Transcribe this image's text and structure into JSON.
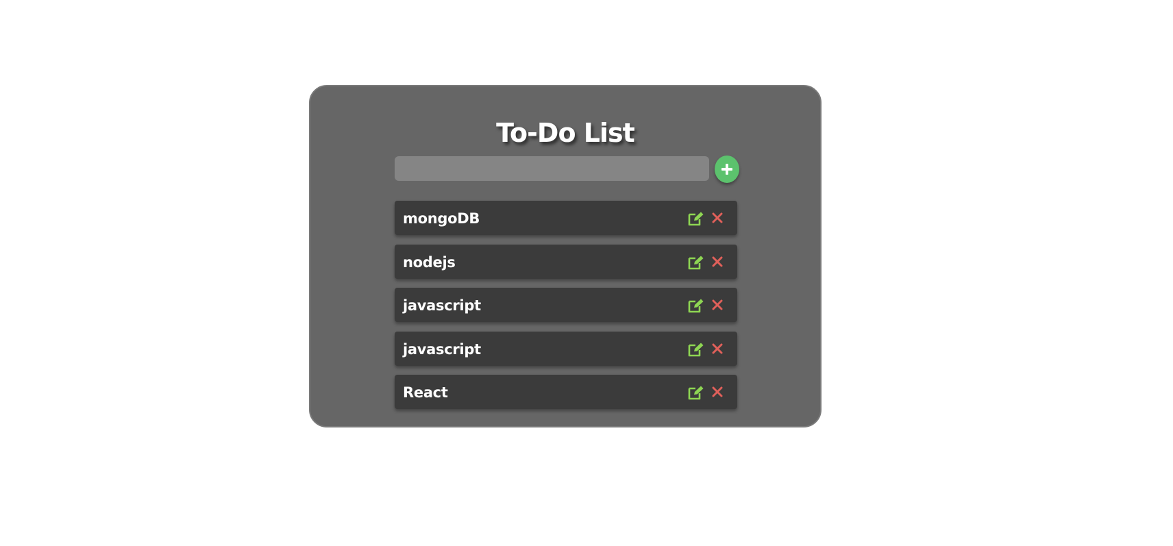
{
  "app": {
    "title": "To-Do List"
  },
  "input": {
    "value": "",
    "placeholder": ""
  },
  "add_button": {
    "icon": "plus-icon"
  },
  "tasks": [
    {
      "label": "mongoDB"
    },
    {
      "label": "nodejs"
    },
    {
      "label": "javascript"
    },
    {
      "label": "javascript"
    },
    {
      "label": "React"
    }
  ],
  "icons": {
    "edit": "edit-icon",
    "delete": "close-icon"
  },
  "colors": {
    "card_bg": "#666666",
    "item_bg": "#3b3b3b",
    "input_bg": "#858585",
    "add_button": "#5cc26d",
    "edit_icon": "#8ed653",
    "delete_icon": "#e0605a"
  }
}
